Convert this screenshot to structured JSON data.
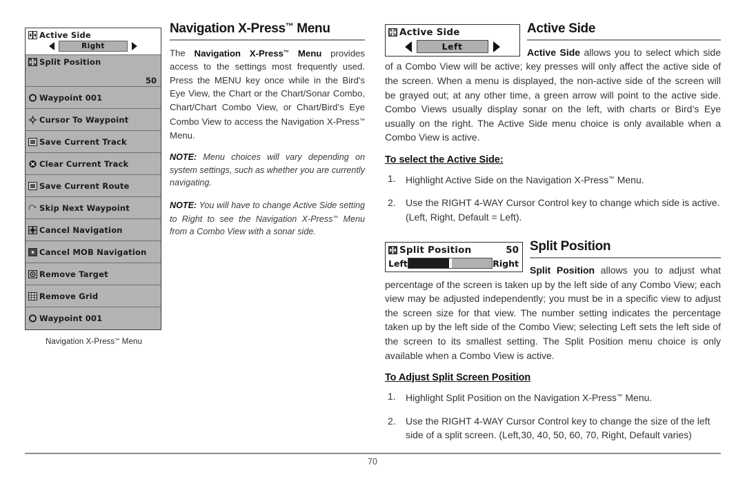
{
  "document": {
    "page_number": "70"
  },
  "lcd_menu": {
    "caption": "Navigation X-Press™ Menu",
    "items": [
      {
        "label": "Active Side",
        "icon": "left-right-arrows-icon",
        "selected": true,
        "control": "slider",
        "value": "Right"
      },
      {
        "label": "Split Position",
        "icon": "left-right-arrows-icon",
        "selected": false,
        "value": "50"
      },
      {
        "label": "Waypoint 001",
        "icon": "waypoint-circle-icon",
        "selected": false,
        "value": ""
      },
      {
        "label": "Cursor To Waypoint",
        "icon": "crosshair-icon",
        "selected": false,
        "value": ""
      },
      {
        "label": "Save Current Track",
        "icon": "save-track-icon",
        "selected": false,
        "value": ""
      },
      {
        "label": "Clear Current Track",
        "icon": "clear-x-circle-icon",
        "selected": false,
        "value": ""
      },
      {
        "label": "Save Current Route",
        "icon": "save-route-icon",
        "selected": false,
        "value": ""
      },
      {
        "label": "Skip Next Waypoint",
        "icon": "skip-arrow-icon",
        "selected": false,
        "value": ""
      },
      {
        "label": "Cancel Navigation",
        "icon": "cancel-navigation-icon",
        "selected": false,
        "value": ""
      },
      {
        "label": "Cancel MOB Navigation",
        "icon": "cancel-mob-icon",
        "selected": false,
        "value": ""
      },
      {
        "label": "Remove Target",
        "icon": "remove-target-icon",
        "selected": false,
        "value": ""
      },
      {
        "label": "Remove Grid",
        "icon": "remove-grid-icon",
        "selected": false,
        "value": ""
      },
      {
        "label": "Waypoint 001",
        "icon": "waypoint-circle-icon",
        "selected": false,
        "value": ""
      }
    ]
  },
  "middle": {
    "title": "Navigation X-Press™ Menu",
    "paragraph_lead": "The ",
    "paragraph_bold": "Navigation X-Press™ Menu",
    "paragraph_rest": " provides access to the settings most frequently used. Press the MENU key once while in the Bird's Eye View, the Chart or the Chart/Sonar Combo, Chart/Chart Combo View, or Chart/Bird’s Eye Combo View to access the Navigation X-Press™ Menu.",
    "note1_label": "NOTE:",
    "note1_text": " Menu choices will vary depending on system settings, such as whether you are currently navigating.",
    "note2_label": "NOTE:",
    "note2_text": " You will have to change Active Side setting to Right to see the Navigation X-Press™ Menu from a Combo View with a sonar side."
  },
  "active_side": {
    "widget": {
      "label": "Active Side",
      "icon": "left-right-arrows-icon",
      "value": "Left",
      "left_arrow": "arrow-left-icon",
      "right_arrow": "arrow-right-icon"
    },
    "title": "Active Side",
    "body_bold": "Active Side",
    "body_text": " allows you to select which side of a Combo View will be active; key presses will only affect the active side of the screen. When a menu is displayed, the non-active side of the screen will be grayed out; at any other time, a green arrow will point to the active side. Combo Views usually display sonar on the left, with charts or Bird’s Eye usually on the right. The Active Side menu choice is only available when a Combo View is active.",
    "subhead": "To select the Active Side:",
    "steps": [
      {
        "num": "1.",
        "text": "Highlight Active Side on the Navigation X-Press™ Menu."
      },
      {
        "num": "2.",
        "text": "Use the RIGHT 4-WAY Cursor Control key to change which side is active. (Left, Right, Default = Left)."
      }
    ]
  },
  "split_position": {
    "widget": {
      "label": "Split Position",
      "icon": "left-right-arrows-icon",
      "value": "50",
      "gauge_left_label": "Left",
      "gauge_right_label": "Right",
      "gauge_percent": 50
    },
    "title": "Split Position",
    "body_bold": "Split Position",
    "body_text": " allows you to adjust what percentage of the screen is taken up by the left side of any Combo View; each view may be adjusted independently; you must be in a specific view to adjust the screen size for that view. The number setting indicates the percentage taken up by the left side of the Combo View; selecting Left sets the left side of the screen to its smallest setting. The Split Position menu choice is only available when a Combo View is active.",
    "subhead": "To Adjust Split Screen Position",
    "steps": [
      {
        "num": "1.",
        "text": "Highlight Split Position on the Navigation X-Press™ Menu."
      },
      {
        "num": "2.",
        "text": "Use the RIGHT 4-WAY Cursor Control key to change the size of the left side of a split screen. (Left,30, 40, 50, 60, 70, Right, Default varies)"
      }
    ]
  },
  "colors": {
    "lcd_background": "#b3b3b3",
    "lcd_selected": "#ffffff",
    "rule": "#8f8f8f",
    "text": "#333333"
  }
}
